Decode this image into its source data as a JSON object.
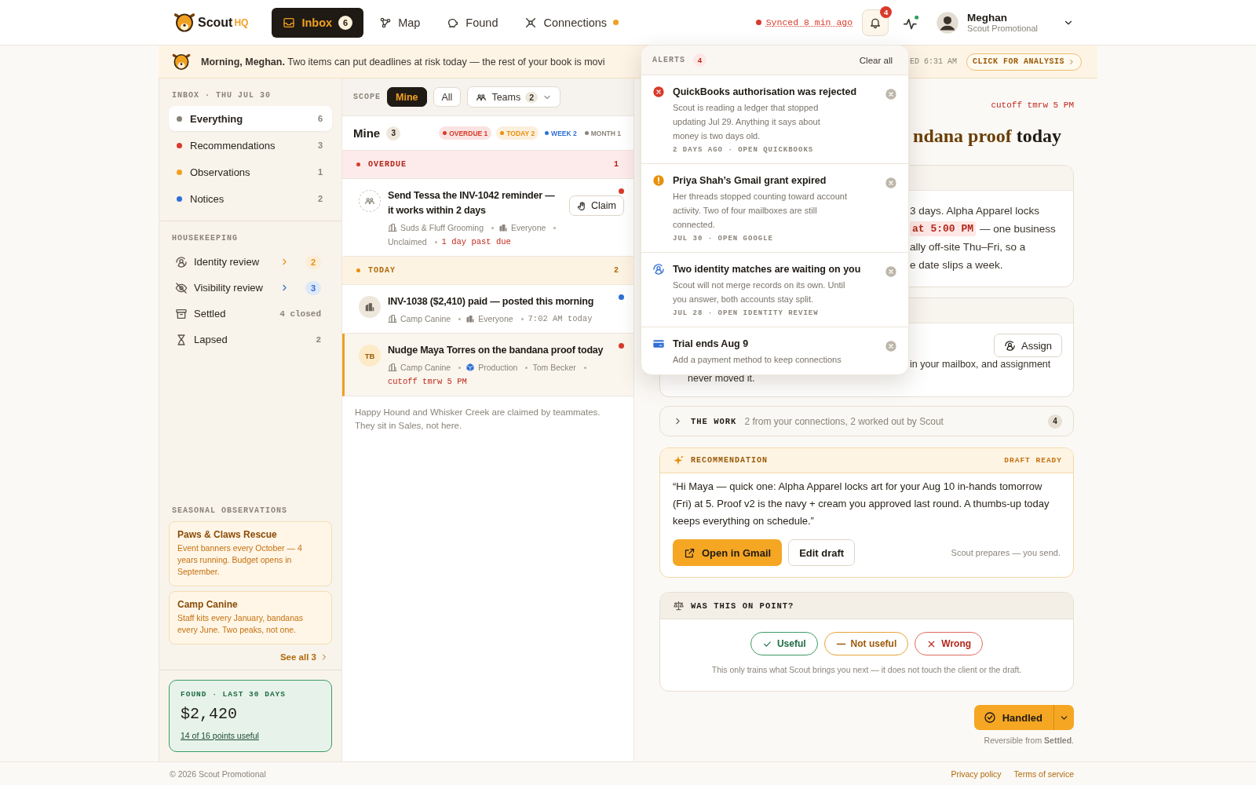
{
  "topbar": {
    "brand": "Scout",
    "brand_suffix": "HQ",
    "nav": [
      {
        "label": "Inbox",
        "badge": "6",
        "selected": true,
        "dot": false
      },
      {
        "label": "Map",
        "selected": false,
        "dot": false
      },
      {
        "label": "Found",
        "selected": false,
        "dot": false
      },
      {
        "label": "Connections",
        "selected": false,
        "dot": true
      }
    ],
    "sync": "Synced 8 min ago",
    "alerts_badge": "4",
    "user": {
      "name": "Meghan",
      "org": "Scout Promotional"
    }
  },
  "banner": {
    "text": "**Morning, Meghan.** Two items can put deadlines at risk today — the rest of your book is movi",
    "updated": "ED 6:31 AM",
    "action": "CLICK FOR ANALYSIS"
  },
  "sidebar": {
    "heading": "INBOX · THU JUL 30",
    "filters": [
      {
        "label": "Everything",
        "count": "6",
        "color": "#8a8478",
        "selected": true
      },
      {
        "label": "Recommendations",
        "count": "3",
        "color": "#d93a2b",
        "selected": false
      },
      {
        "label": "Observations",
        "count": "1",
        "color": "#f0a020",
        "selected": false
      },
      {
        "label": "Notices",
        "count": "2",
        "color": "#2f6fd6",
        "selected": false
      }
    ],
    "housekeeping_heading": "HOUSEKEEPING",
    "housekeeping": [
      {
        "label": "Identity review",
        "kind": "review",
        "count": "2",
        "color": "#e8900c"
      },
      {
        "label": "Visibility review",
        "kind": "review",
        "count": "3",
        "color": "#2f6fd6"
      },
      {
        "label": "Settled",
        "kind": "plain",
        "count": "4 closed"
      },
      {
        "label": "Lapsed",
        "kind": "plain",
        "count": "2"
      }
    ],
    "seasonal_heading": "SEASONAL OBSERVATIONS",
    "seasonal": [
      {
        "title": "Paws & Claws Rescue",
        "text": "Event banners every October — 4 years running. Budget opens in September."
      },
      {
        "title": "Camp Canine",
        "text": "Staff kits every January, bandanas every June. Two peaks, not one."
      }
    ],
    "see_all": "See all 3",
    "found": {
      "label": "FOUND · LAST 30 DAYS",
      "amount": "$2,420",
      "link": "14 of 16 points useful"
    }
  },
  "scope": {
    "label": "SCOPE",
    "options": [
      {
        "label": "Mine",
        "selected": true
      },
      {
        "label": "All",
        "selected": false
      }
    ],
    "teams": {
      "label": "Teams",
      "count": "2"
    }
  },
  "list": {
    "title": "Mine",
    "count": "3",
    "chips": [
      {
        "label": "OVERDUE",
        "count": "1",
        "color": "#d93a2b",
        "kind": "pill"
      },
      {
        "label": "TODAY",
        "count": "2",
        "color": "#e8900c",
        "kind": "pill"
      },
      {
        "label": "WEEK",
        "count": "2",
        "color": "#2f6fd6",
        "kind": "plain"
      },
      {
        "label": "MONTH",
        "count": "1",
        "color": "#8a8478",
        "kind": "plain"
      }
    ],
    "sections": [
      {
        "label": "OVERDUE",
        "count": "1",
        "kind": "overdue",
        "items": [
          {
            "title": "Send Tessa the INV-1042 reminder — it works within 2 days",
            "avatar": {
              "kind": "team"
            },
            "color": "#d93a2b",
            "selected": false,
            "action": "Claim",
            "meta": [
              {
                "text": "Suds & Fluff Grooming",
                "kind": "client"
              },
              {
                "text": "Everyone",
                "kind": "team"
              },
              {
                "text": "Unclaimed",
                "kind": "status"
              },
              {
                "text": "1 day past due",
                "kind": "due"
              }
            ]
          }
        ]
      },
      {
        "label": "TODAY",
        "count": "2",
        "kind": "today",
        "items": [
          {
            "title": "INV-1038 ($2,410) paid — posted this morning",
            "avatar": {
              "kind": "building"
            },
            "color": "#2f6fd6",
            "selected": false,
            "meta": [
              {
                "text": "Camp Canine",
                "kind": "client"
              },
              {
                "text": "Everyone",
                "kind": "team"
              },
              {
                "text": "7:02 AM today",
                "kind": "time"
              }
            ]
          },
          {
            "title": "Nudge Maya Torres on the bandana proof today",
            "avatar": {
              "kind": "initials",
              "text": "TB"
            },
            "color": "#d93a2b",
            "selected": true,
            "meta": [
              {
                "text": "Camp Canine",
                "kind": "client"
              },
              {
                "text": "Production",
                "kind": "production"
              },
              {
                "text": "Tom Becker",
                "kind": "person"
              },
              {
                "text": "cutoff tmrw 5 PM",
                "kind": "due"
              }
            ]
          }
        ]
      }
    ],
    "note": "Happy Hound and Whisker Creek are claimed by teammates. They sit in Sales, not here."
  },
  "alerts": {
    "title": "ALERTS",
    "count": "4",
    "clear": "Clear all",
    "items": [
      {
        "kind": "error",
        "title": "QuickBooks authorisation was rejected",
        "body": "Scout is reading a ledger that stopped updating Jul 29. Anything it says about money is two days old.",
        "meta": "2 DAYS AGO · OPEN QUICKBOOKS"
      },
      {
        "kind": "warning",
        "title": "Priya Shah’s Gmail grant expired",
        "body": "Her threads stopped counting toward account activity. Two of four mailboxes are still connected.",
        "meta": "JUL 30 · OPEN GOOGLE"
      },
      {
        "kind": "identity",
        "title": "Two identity matches are waiting on you",
        "body": "Scout will not merge records on its own. Until you answer, both accounts stay split.",
        "meta": "JUL 28 · OPEN IDENTITY REVIEW"
      },
      {
        "kind": "billing",
        "title": "Trial ends Aug 9",
        "body": "Add a payment method to keep connections"
      }
    ]
  },
  "detail": {
    "cutoff": "cutoff tmrw 5 PM",
    "heading": [
      {
        "text": "ndana proof",
        "kind": "accent"
      },
      {
        "text": "today",
        "kind": "plain"
      }
    ],
    "summary_lines": [
      [
        {
          "kind": "text",
          "text": "3 days. Alpha Apparel locks"
        }
      ],
      [
        {
          "kind": "highlight",
          "text": "at 5:00 PM"
        },
        {
          "kind": "text",
          "text": "— one business"
        }
      ],
      [
        {
          "kind": "text",
          "text": "ally off-site Thu–Fri, so a"
        }
      ],
      [
        {
          "kind": "text",
          "text": "e date slips a week."
        }
      ]
    ],
    "assign": {
      "action": "Assign",
      "peek_line": "in your mailbox, and assignment",
      "line": "never moved it."
    },
    "work": {
      "label": "THE WORK",
      "text": "2 from your connections, 2 worked out by Scout",
      "count": "4",
      "expanded": false
    },
    "recommendation": {
      "label": "RECOMMENDATION",
      "status": "DRAFT READY",
      "quote": "“Hi Maya — quick one: Alpha Apparel locks art for your Aug 10 in-hands tomorrow (Fri) at 5. Proof v2 is the navy + cream you approved last round. A thumbs-up today keeps everything on schedule.”",
      "primary": "Open in Gmail",
      "secondary": "Edit draft",
      "note": "Scout prepares — you send."
    },
    "feedback": {
      "label": "WAS THIS ON POINT?",
      "options": [
        {
          "label": "Useful",
          "kind": "useful"
        },
        {
          "label": "Not useful",
          "kind": "neutral"
        },
        {
          "label": "Wrong",
          "kind": "wrong"
        }
      ],
      "note": "This only trains what Scout brings you next — it does not touch the client or the draft."
    },
    "handled": {
      "label": "Handled",
      "note": "Reversible from **Settled**."
    }
  },
  "footer": {
    "copyright": "© 2026 Scout Promotional",
    "links": [
      "Privacy policy",
      "Terms of service"
    ]
  }
}
